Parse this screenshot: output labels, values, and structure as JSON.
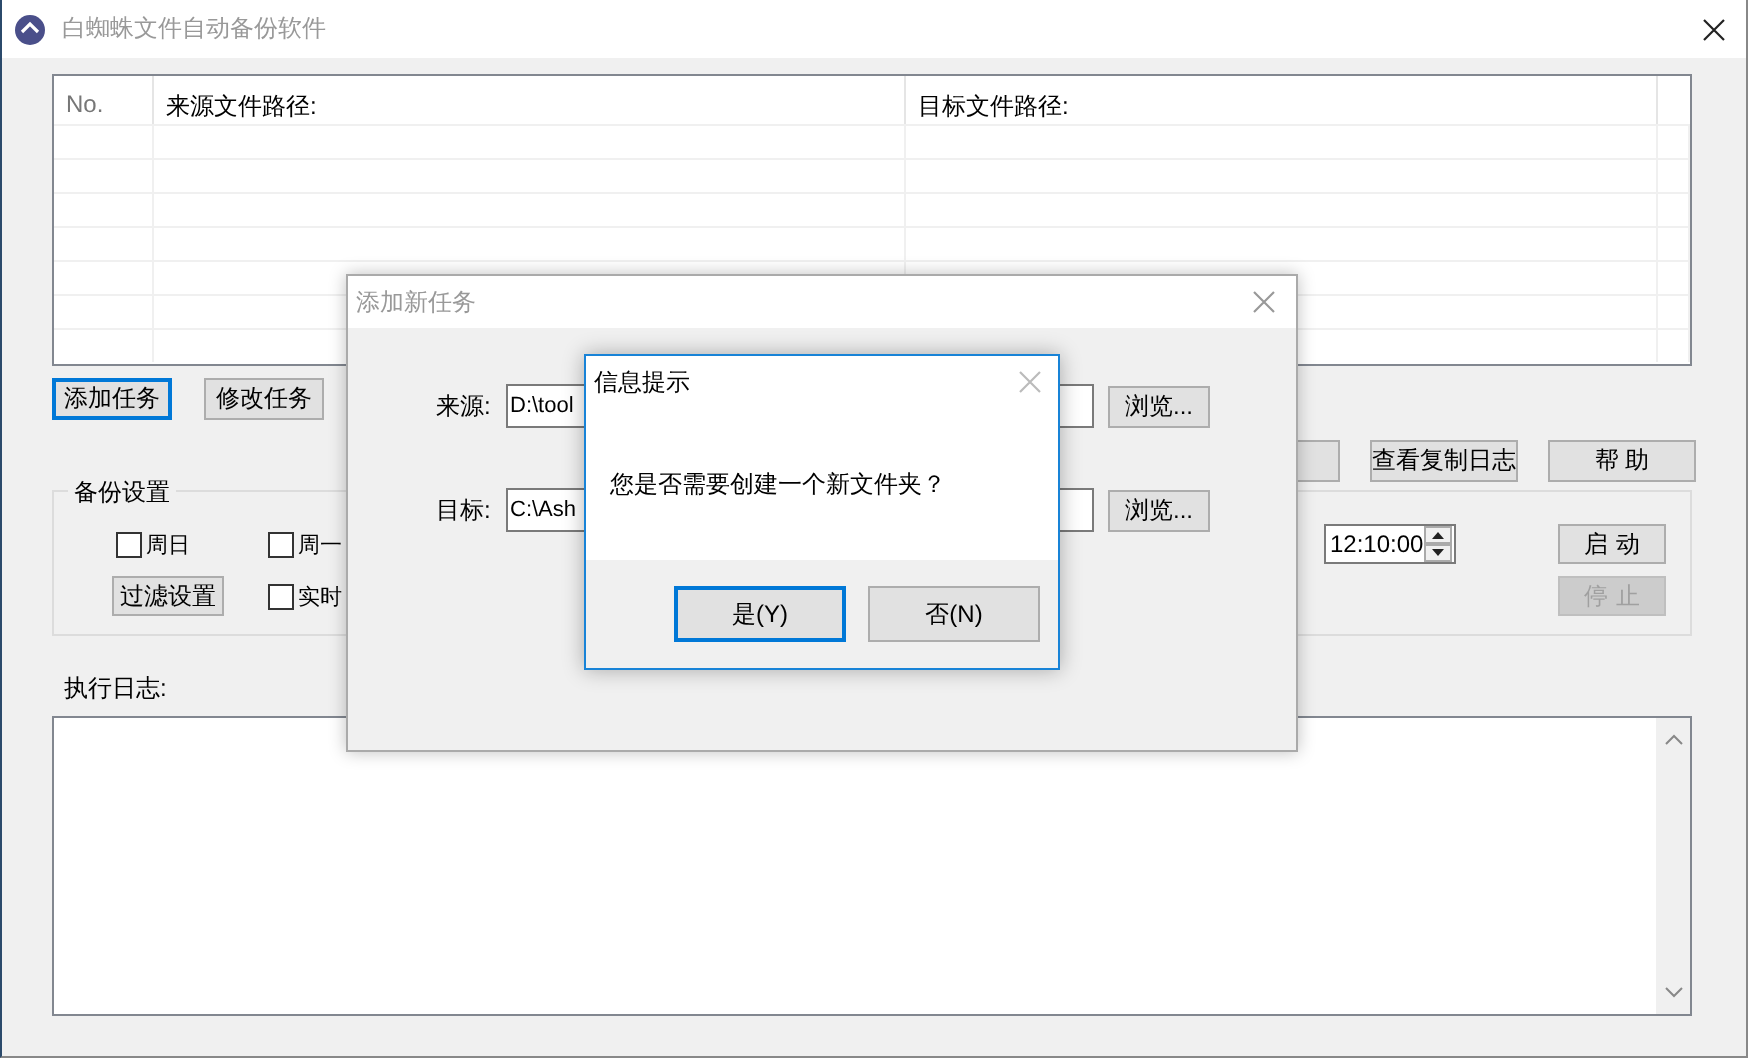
{
  "window": {
    "title": "白蜘蛛文件自动备份软件"
  },
  "task_table": {
    "columns": [
      "No.",
      "来源文件路径:",
      "目标文件路径:"
    ]
  },
  "task_buttons": [
    {
      "label": "添加任务",
      "focused": true
    },
    {
      "label": "修改任务",
      "focused": false
    }
  ],
  "right_buttons": [
    {
      "label": "查看复制日志"
    },
    {
      "label": "帮 助"
    }
  ],
  "backup_settings": {
    "title": "备份设置",
    "checkboxes": [
      {
        "label": "周日",
        "checked": false
      },
      {
        "label": "周一",
        "checked": false
      },
      {
        "label": "实时",
        "checked": false
      }
    ],
    "filter_button": "过滤设置",
    "time": "12:10:00",
    "run_buttons": [
      {
        "label": "启动",
        "disabled": false
      },
      {
        "label": "停止",
        "disabled": true
      }
    ]
  },
  "log": {
    "label": "执行日志:"
  },
  "add_task_dialog": {
    "title": "添加新任务",
    "active": false,
    "fields": [
      {
        "label": "来源:",
        "value": "D:\\tool",
        "button": "浏览..."
      },
      {
        "label": "目标:",
        "value": "C:\\Ash",
        "button": "浏览..."
      }
    ]
  },
  "message_box": {
    "title": "信息提示",
    "message": "您是否需要创建一个新文件夹？",
    "buttons": [
      {
        "label": "是(Y)",
        "focused": true
      },
      {
        "label": "否(N)",
        "focused": false
      }
    ]
  }
}
